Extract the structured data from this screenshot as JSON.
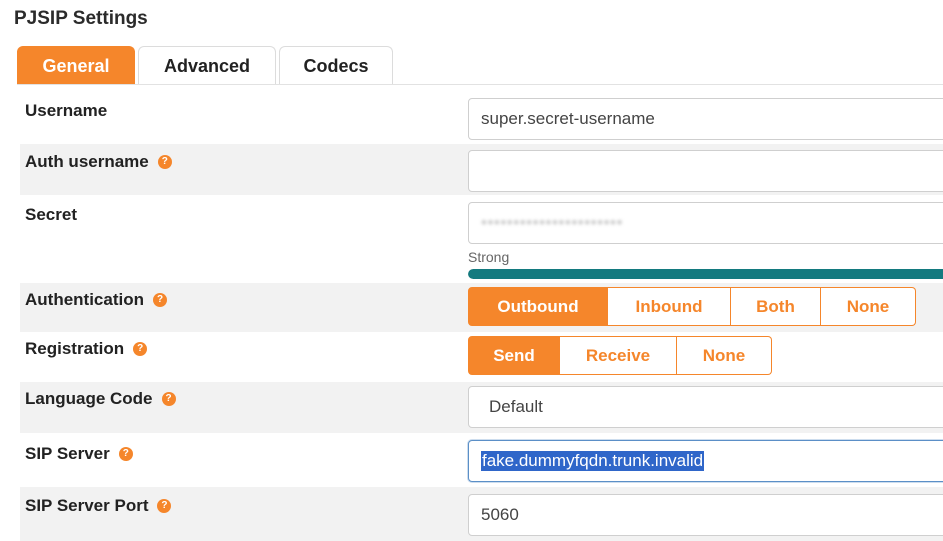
{
  "page": {
    "title": "PJSIP Settings"
  },
  "tabs": [
    {
      "label": "General",
      "active": true
    },
    {
      "label": "Advanced",
      "active": false
    },
    {
      "label": "Codecs",
      "active": false
    }
  ],
  "fields": {
    "username": {
      "label": "Username",
      "value": "super.secret-username"
    },
    "auth_username": {
      "label": "Auth username",
      "value": ""
    },
    "secret": {
      "label": "Secret",
      "value": "••••••••••••••••••••••",
      "strength_label": "Strong",
      "strength": 1.0
    },
    "authentication": {
      "label": "Authentication",
      "options": [
        "Outbound",
        "Inbound",
        "Both",
        "None"
      ],
      "selected": "Outbound"
    },
    "registration": {
      "label": "Registration",
      "options": [
        "Send",
        "Receive",
        "None"
      ],
      "selected": "Send"
    },
    "language_code": {
      "label": "Language Code",
      "value": "Default"
    },
    "sip_server": {
      "label": "SIP Server",
      "value": "fake.dummyfqdn.trunk.invalid"
    },
    "sip_server_port": {
      "label": "SIP Server Port",
      "value": "5060"
    }
  },
  "help_icon": "question-circle-icon",
  "colors": {
    "accent": "#f5862b",
    "strength": "#137a7f",
    "selection": "#2f66c9"
  }
}
